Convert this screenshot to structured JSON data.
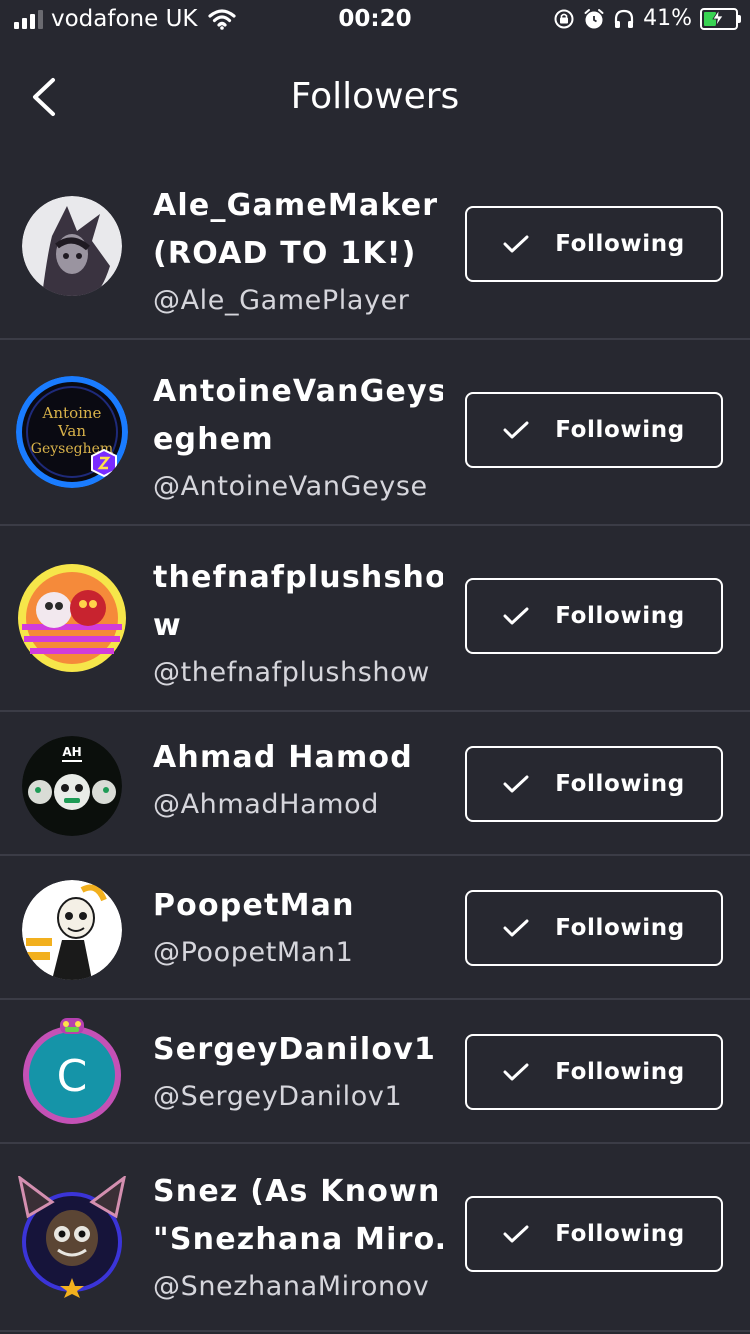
{
  "status": {
    "carrier": "vodafone UK",
    "time": "00:20",
    "battery": "41%",
    "battery_level": 0.41,
    "icons": [
      "signal-icon",
      "wifi-icon",
      "orientation-lock-icon",
      "alarm-icon",
      "headphones-icon",
      "battery-charging-icon"
    ]
  },
  "header": {
    "title": "Followers",
    "back_icon": "chevron-left-icon"
  },
  "followers": [
    {
      "name_lines": [
        "Ale_GameMaker",
        "(ROAD TO 1K!)"
      ],
      "handle": "@Ale_GamePlayer",
      "button": "Following",
      "avatar_icon": "anime-character-avatar"
    },
    {
      "name_lines": [
        "AntoineVanGeys",
        "eghem"
      ],
      "handle": "@AntoineVanGeyse",
      "button": "Following",
      "avatar_icon": "blue-ring-avatar",
      "avatar_text": [
        "Antoine",
        "Van",
        "Geyseghem"
      ]
    },
    {
      "name_lines": [
        "thefnafplushsho",
        "w"
      ],
      "handle": "@thefnafplushshow",
      "button": "Following",
      "avatar_icon": "plush-sunset-avatar"
    },
    {
      "name_lines": [
        "Ahmad Hamod"
      ],
      "handle": "@AhmadHamod",
      "button": "Following",
      "avatar_icon": "animatronic-avatar",
      "avatar_text": [
        "AH"
      ]
    },
    {
      "name_lines": [
        "PoopetMan"
      ],
      "handle": "@PoopetMan1",
      "button": "Following",
      "avatar_icon": "puppet-avatar"
    },
    {
      "name_lines": [
        "SergeyDanilov1"
      ],
      "handle": "@SergeyDanilov1",
      "button": "Following",
      "avatar_icon": "letter-c-avatar",
      "avatar_text": [
        "C"
      ]
    },
    {
      "name_lines": [
        "Snez (As Known",
        "\"Snezhana Miro…"
      ],
      "handle": "@SnezhanaMironov",
      "button": "Following",
      "avatar_icon": "cat-character-avatar"
    }
  ],
  "colors": {
    "background": "#272830",
    "divider": "#3b3c46",
    "text": "#ffffff",
    "handle": "#d6d6dc",
    "battery": "#39d353"
  }
}
